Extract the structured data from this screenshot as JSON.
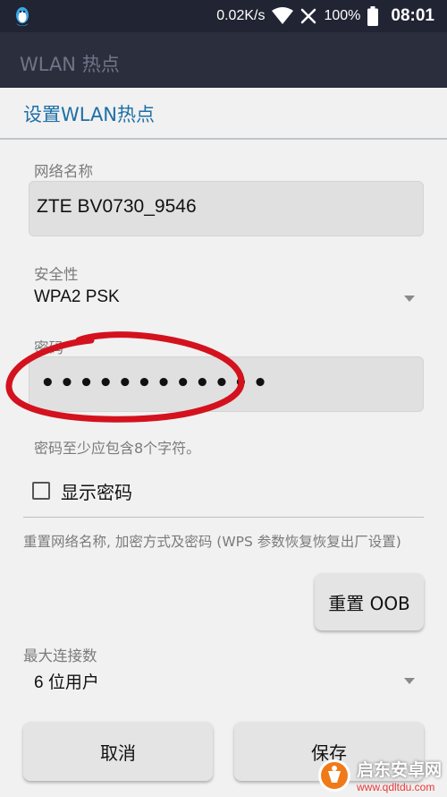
{
  "status_bar": {
    "network_speed": "0.02K/s",
    "battery_percent": "100%",
    "time": "08:01",
    "icons": [
      "qq-penguin-icon",
      "wifi-icon",
      "no-signal-icon",
      "battery-icon"
    ]
  },
  "app_bar": {
    "title": "WLAN 热点"
  },
  "dialog": {
    "title": "设置WLAN热点",
    "network_name": {
      "label": "网络名称",
      "value": "ZTE BV0730_9546"
    },
    "security": {
      "label": "安全性",
      "value": "WPA2 PSK"
    },
    "password": {
      "label": "密码",
      "value": "••••••••••••"
    },
    "password_hint": "密码至少应包含8个字符。",
    "show_password": {
      "label": "显示密码",
      "checked": false
    },
    "reset_description": "重置网络名称, 加密方式及密码 (WPS 参数恢复恢复出厂设置)",
    "reset_button": "重置 OOB",
    "max_connections": {
      "label": "最大连接数",
      "value": "6 位用户"
    },
    "cancel_button": "取消",
    "save_button": "保存"
  },
  "watermark": {
    "name": "启东安卓网",
    "url": "www.qdltdu.com"
  },
  "colors": {
    "status_bar_bg": "#212433",
    "app_bar_bg": "#2b2f3d",
    "dialog_bg": "#f1f1f1",
    "dialog_title": "#1d6fa6",
    "annotation_stroke": "#d3121e"
  }
}
